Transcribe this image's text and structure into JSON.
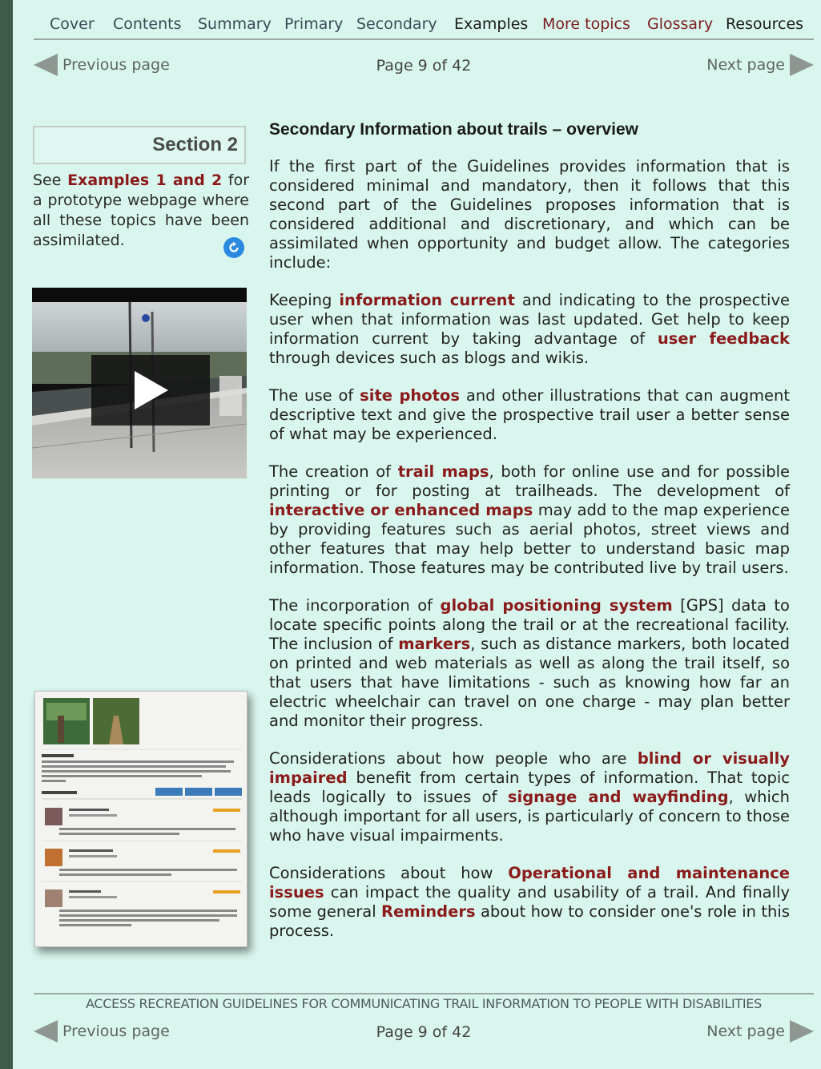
{
  "nav": {
    "items": [
      "Cover",
      "Contents",
      "Summary",
      "Primary",
      "Secondary",
      "Examples",
      "More topics",
      "Glossary",
      "Resources"
    ]
  },
  "pager": {
    "prev": "Previous page",
    "next": "Next page",
    "page": "Page 9 of 42"
  },
  "sidebar": {
    "section": "Section 2",
    "see": "See ",
    "examples_link": "Examples 1 and 2",
    "rest": " for a prototype webpage where all these topics have been assimilated."
  },
  "main": {
    "heading": "Secondary Information about trails – overview",
    "p1": "If the first part of the Guidelines provides information that is considered minimal and mandatory, then it follows that this second part of the Guidelines proposes information that is considered additional and discretionary, and which can be assimilated when opportunity and budget allow. The categories include:",
    "p2": [
      "Keeping ",
      "information current",
      " and indicating to the prospective user when that information was last updated. Get help to keep information current by taking advantage of ",
      "user feedback",
      " through devices such as blogs and wikis."
    ],
    "p3": [
      "The use of ",
      "site photos",
      " and other illustrations that can augment descriptive text and give the prospective trail user a better sense of what may be experienced."
    ],
    "p4": [
      "The creation of ",
      "trail maps",
      ", both for online use and for possible printing or for posting at trailheads. The development of ",
      "interactive or enhanced maps",
      " may add to the map experience by providing features such as aerial photos, street views and other features that may help better to understand basic map information. Those features may be contributed live by trail users."
    ],
    "p5": [
      "The incorporation of ",
      "global positioning system",
      " [GPS] data to locate specific points along the trail or at the recreational facility. The inclusion of ",
      "markers",
      ", such as distance markers, both located on printed and web materials as well as along the trail itself, so that users that have limitations - such as knowing how far an electric wheelchair can travel on one charge - may plan better and monitor their progress."
    ],
    "p6": [
      "Considerations about how people who are ",
      "blind or visually impaired",
      " benefit from certain types of information. That topic leads logically to issues of ",
      "signage and wayfinding",
      ", which although important for all users, is particularly of concern to those who have visual impairments."
    ],
    "p7": [
      "Considerations about how ",
      "Operational and maintenance issues",
      " can impact the quality and usability of a trail. And finally some general ",
      "Reminders",
      " about how to consider one's role in this process."
    ]
  },
  "footer": {
    "title": "ACCESS RECREATION GUIDELINES FOR COMMUNICATING TRAIL INFORMATION TO PEOPLE WITH DISABILITIES"
  },
  "colors": {
    "accent": "#8a1b1b",
    "background": "#d9f6ee"
  },
  "icons": {
    "prev": "left-arrow-icon",
    "next": "right-arrow-icon",
    "link": "circular-arrow-icon",
    "video": "play-icon"
  }
}
